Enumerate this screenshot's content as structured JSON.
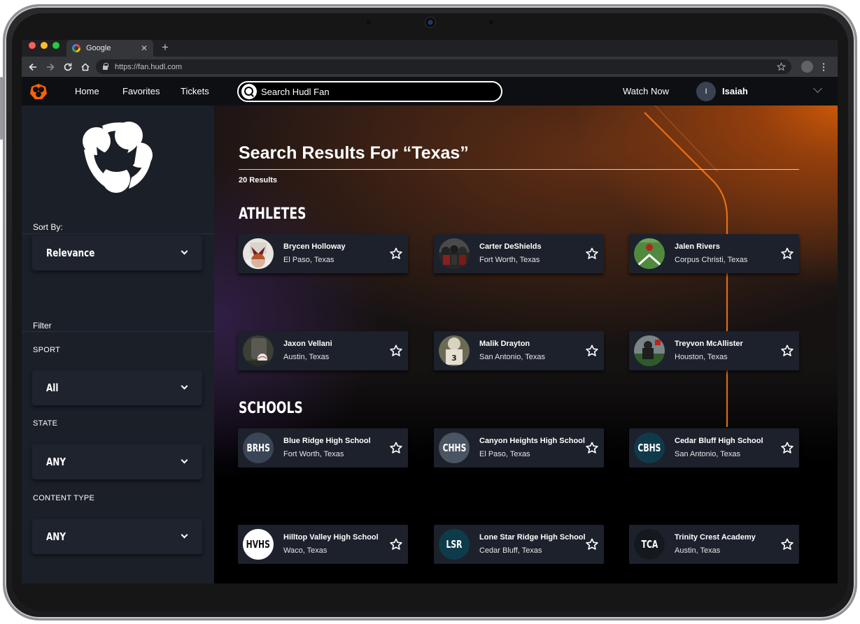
{
  "browser": {
    "tab_title": "Google",
    "tab_close": "✕",
    "new_tab": "+",
    "url": "https://fan.hudl.com",
    "window_dot_colors": [
      "#ff5f57",
      "#febc2e",
      "#28c840"
    ]
  },
  "header": {
    "nav": [
      "Home",
      "Favorites",
      "Tickets"
    ],
    "search_placeholder": "Search Hudl Fan",
    "watch_now": "Watch Now",
    "user_initial": "I",
    "user_name": "Isaiah",
    "accent_color": "#ff6300"
  },
  "sidebar": {
    "sort_by_label": "Sort By:",
    "sort_value": "Relevance",
    "filter_label": "Filter",
    "filters": [
      {
        "label": "SPORT",
        "value": "All"
      },
      {
        "label": "STATE",
        "value": "ANY"
      },
      {
        "label": "CONTENT TYPE",
        "value": "ANY"
      }
    ]
  },
  "main": {
    "title": "Search Results For “Texas”",
    "results_count": "20 Results",
    "athletes_heading": "ATHLETES",
    "schools_heading": "SCHOOLS",
    "athletes": [
      {
        "name": "Brycen Holloway",
        "location": "El Paso, Texas"
      },
      {
        "name": "Carter DeShields",
        "location": "Fort Worth, Texas"
      },
      {
        "name": "Jalen Rivers",
        "location": "Corpus Christi, Texas"
      },
      {
        "name": "Jaxon Vellani",
        "location": "Austin, Texas"
      },
      {
        "name": "Malik Drayton",
        "location": "San Antonio, Texas"
      },
      {
        "name": "Treyvon McAllister",
        "location": "Houston, Texas"
      }
    ],
    "schools": [
      {
        "abbr": "BRHS",
        "name": "Blue Ridge High School",
        "location": "Fort Worth, Texas",
        "bg": "#3a4656",
        "fg": "#ffffff"
      },
      {
        "abbr": "CHHS",
        "name": "Canyon Heights High School",
        "location": "El Paso, Texas",
        "bg": "#4a5564",
        "fg": "#ffffff"
      },
      {
        "abbr": "CBHS",
        "name": "Cedar Bluff High School",
        "location": "San Antonio, Texas",
        "bg": "#0f3a4a",
        "fg": "#ffffff"
      },
      {
        "abbr": "HVHS",
        "name": "Hilltop Valley High School",
        "location": "Waco, Texas",
        "bg": "#ffffff",
        "fg": "#111111"
      },
      {
        "abbr": "LSR",
        "name": "Lone Star Ridge High School",
        "location": "Cedar Bluff, Texas",
        "bg": "#0e3b4a",
        "fg": "#ffffff"
      },
      {
        "abbr": "TCA",
        "name": "Trinity Crest Academy",
        "location": "Austin, Texas",
        "bg": "#15191f",
        "fg": "#ffffff"
      }
    ]
  }
}
